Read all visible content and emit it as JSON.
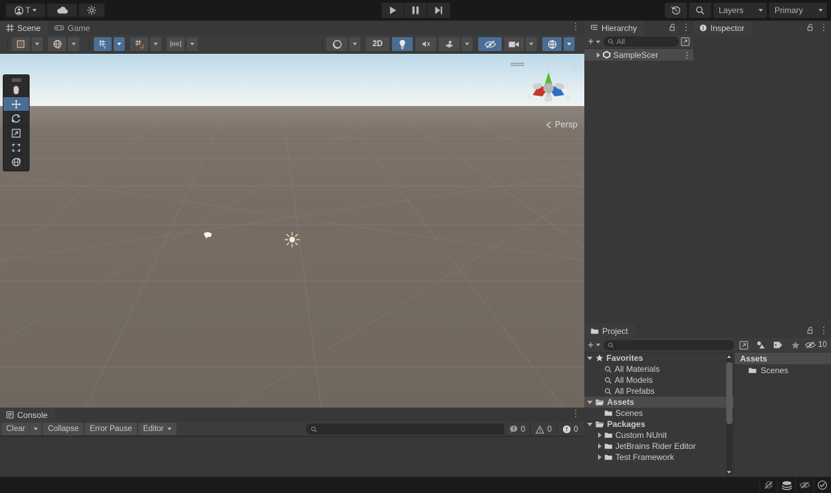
{
  "app": {
    "name": "Unity Editor"
  },
  "toolbar": {
    "account_label": "T",
    "account_icon": "account-icon",
    "cloud_icon": "cloud-icon",
    "settings_icon": "services-settings-icon",
    "play_icon": "play-icon",
    "pause_icon": "pause-icon",
    "step_icon": "step-icon",
    "undo_history_icon": "undo-history-icon",
    "search_icon": "search-icon",
    "layers_label": "Layers",
    "layout_label": "Primary"
  },
  "scene": {
    "tabs": [
      {
        "label": "Scene",
        "icon": "scene-grid-icon",
        "active": true
      },
      {
        "label": "Game",
        "icon": "gamepad-icon",
        "active": false
      }
    ],
    "toolbar": {
      "draw_mode_icon": "shaded-mode-icon",
      "shading_icon": "globe-lighting-icon",
      "grid_icon": "grid-visibility-icon",
      "snap_icon": "grid-snap-icon",
      "snap_increment_icon": "snap-increment-icon",
      "gizmo_shape_icon": "sphere-icon",
      "mode_2d_label": "2D",
      "light_icon": "lightbulb-icon",
      "audio_icon": "audio-mute-icon",
      "fx_icon": "effects-icon",
      "hidden_icon": "hidden-objects-icon",
      "camera_icon": "scene-camera-icon",
      "gizmos_icon": "gizmos-icon"
    },
    "tools": [
      {
        "name": "hand-tool",
        "icon": "hand-icon",
        "selected": false
      },
      {
        "name": "move-tool",
        "icon": "move-icon",
        "selected": true
      },
      {
        "name": "rotate-tool",
        "icon": "rotate-icon",
        "selected": false
      },
      {
        "name": "scale-tool",
        "icon": "scale-icon",
        "selected": false
      },
      {
        "name": "rect-tool",
        "icon": "rect-icon",
        "selected": false
      },
      {
        "name": "transform-tool",
        "icon": "transform-icon",
        "selected": false
      }
    ],
    "gizmo": {
      "x_label": "x",
      "y_label": "y",
      "z_label": "z",
      "projection_label": "Persp",
      "x_color": "#c1392b",
      "y_color": "#55b82e",
      "z_color": "#2e6fc4"
    },
    "objects": [
      {
        "name": "camera-gizmo",
        "icon": "camera-icon"
      },
      {
        "name": "directional-light-gizmo",
        "icon": "sun-icon"
      }
    ],
    "sky_top_color": "#bcd9e8",
    "ground_color": "#776d65"
  },
  "console": {
    "tab_label": "Console",
    "tab_icon": "console-icon",
    "clear_label": "Clear",
    "collapse_label": "Collapse",
    "error_pause_label": "Error Pause",
    "editor_label": "Editor",
    "search_placeholder": "",
    "counters": [
      {
        "name": "log-count",
        "icon": "info-icon",
        "value": "0"
      },
      {
        "name": "warning-count",
        "icon": "warning-icon",
        "value": "0"
      },
      {
        "name": "error-count",
        "icon": "error-icon",
        "value": "0"
      }
    ]
  },
  "hierarchy": {
    "tab_label": "Hierarchy",
    "tab_icon": "hierarchy-icon",
    "lock_icon": "lock-open-icon",
    "kebab_icon": "kebab-menu-icon",
    "add_label": "+",
    "search_placeholder": "All",
    "search_icon": "search-icon",
    "expand_icon": "expand-window-icon",
    "items": [
      {
        "label": "SampleScer",
        "icon": "unity-scene-icon",
        "expandable": true,
        "selected": true
      }
    ]
  },
  "inspector": {
    "tab_label": "Inspector",
    "tab_icon": "info-circle-icon",
    "lock_icon": "lock-open-icon",
    "kebab_icon": "kebab-menu-icon"
  },
  "project": {
    "tab_label": "Project",
    "tab_icon": "folder-icon",
    "lock_icon": "lock-open-icon",
    "kebab_icon": "kebab-menu-icon",
    "add_label": "+",
    "search_placeholder": "",
    "search_icon": "search-icon",
    "expand_icon": "expand-window-icon",
    "filter_type_icon": "filter-by-type-icon",
    "filter_label_icon": "filter-by-label-icon",
    "favorites_icon": "star-icon",
    "hidden_packages_icon": "hidden-eye-icon",
    "hidden_packages_count": "10",
    "tree": [
      {
        "label": "Favorites",
        "icon": "star-icon",
        "depth": 0,
        "expanded": true,
        "bold": true
      },
      {
        "label": "All Materials",
        "icon": "search-icon",
        "depth": 1,
        "expanded": null,
        "bold": false
      },
      {
        "label": "All Models",
        "icon": "search-icon",
        "depth": 1,
        "expanded": null,
        "bold": false
      },
      {
        "label": "All Prefabs",
        "icon": "search-icon",
        "depth": 1,
        "expanded": null,
        "bold": false
      },
      {
        "label": "Assets",
        "icon": "folder-open-icon",
        "depth": 0,
        "expanded": true,
        "bold": true,
        "selected": true
      },
      {
        "label": "Scenes",
        "icon": "folder-icon",
        "depth": 1,
        "expanded": null,
        "bold": false
      },
      {
        "label": "Packages",
        "icon": "folder-open-icon",
        "depth": 0,
        "expanded": true,
        "bold": true
      },
      {
        "label": "Custom NUnit",
        "icon": "folder-icon",
        "depth": 1,
        "expanded": false,
        "bold": false
      },
      {
        "label": "JetBrains Rider Editor",
        "icon": "folder-icon",
        "depth": 1,
        "expanded": false,
        "bold": false
      },
      {
        "label": "Test Framework",
        "icon": "folder-icon",
        "depth": 1,
        "expanded": false,
        "bold": false
      }
    ],
    "content_header": "Assets",
    "content_items": [
      {
        "label": "Scenes",
        "icon": "folder-icon"
      }
    ]
  },
  "statusbar": {
    "icons": [
      {
        "name": "code-debug-disabled-icon"
      },
      {
        "name": "layers-stack-icon"
      },
      {
        "name": "preview-packages-disabled-icon"
      },
      {
        "name": "check-circle-icon"
      }
    ]
  }
}
